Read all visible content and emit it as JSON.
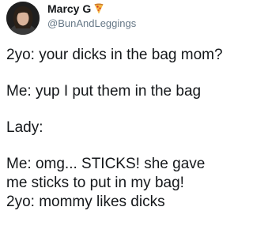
{
  "tweet": {
    "author": {
      "display_name": "Marcy G",
      "badge_icon": "pizza-icon",
      "handle": "@BunAndLeggings"
    },
    "lines": [
      "2yo: your dicks in the bag mom?",
      "Me: yup I put them in the bag",
      "Lady:",
      "Me: omg... STICKS! she gave me sticks to put in my bag!",
      "2yo: mommy likes dicks"
    ]
  },
  "colors": {
    "text": "#14171a",
    "handle": "#657786",
    "background": "#ffffff"
  }
}
